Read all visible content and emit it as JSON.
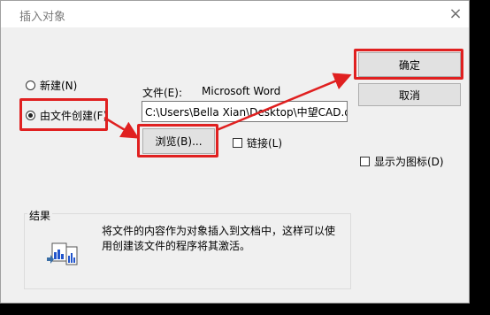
{
  "dialog": {
    "title": "插入对象",
    "close_glyph": "×"
  },
  "options": {
    "new": "新建(N)",
    "from_file": "由文件创建(F)"
  },
  "file": {
    "label": "文件(E):",
    "app_name": "Microsoft Word",
    "path": "C:\\Users\\Bella Xian\\Desktop\\中望CAD.dc"
  },
  "buttons": {
    "ok": "确定",
    "cancel": "取消",
    "browse": "浏览(B)..."
  },
  "checkboxes": {
    "link": "链接(L)",
    "display_as_icon": "显示为图标(D)"
  },
  "result": {
    "title": "结果",
    "text": "将文件的内容作为对象插入到文档中，这样可以使用创建该文件的程序将其激活。"
  },
  "annotation_color": "#e02020",
  "icons": [
    "close-icon",
    "document-icon"
  ]
}
